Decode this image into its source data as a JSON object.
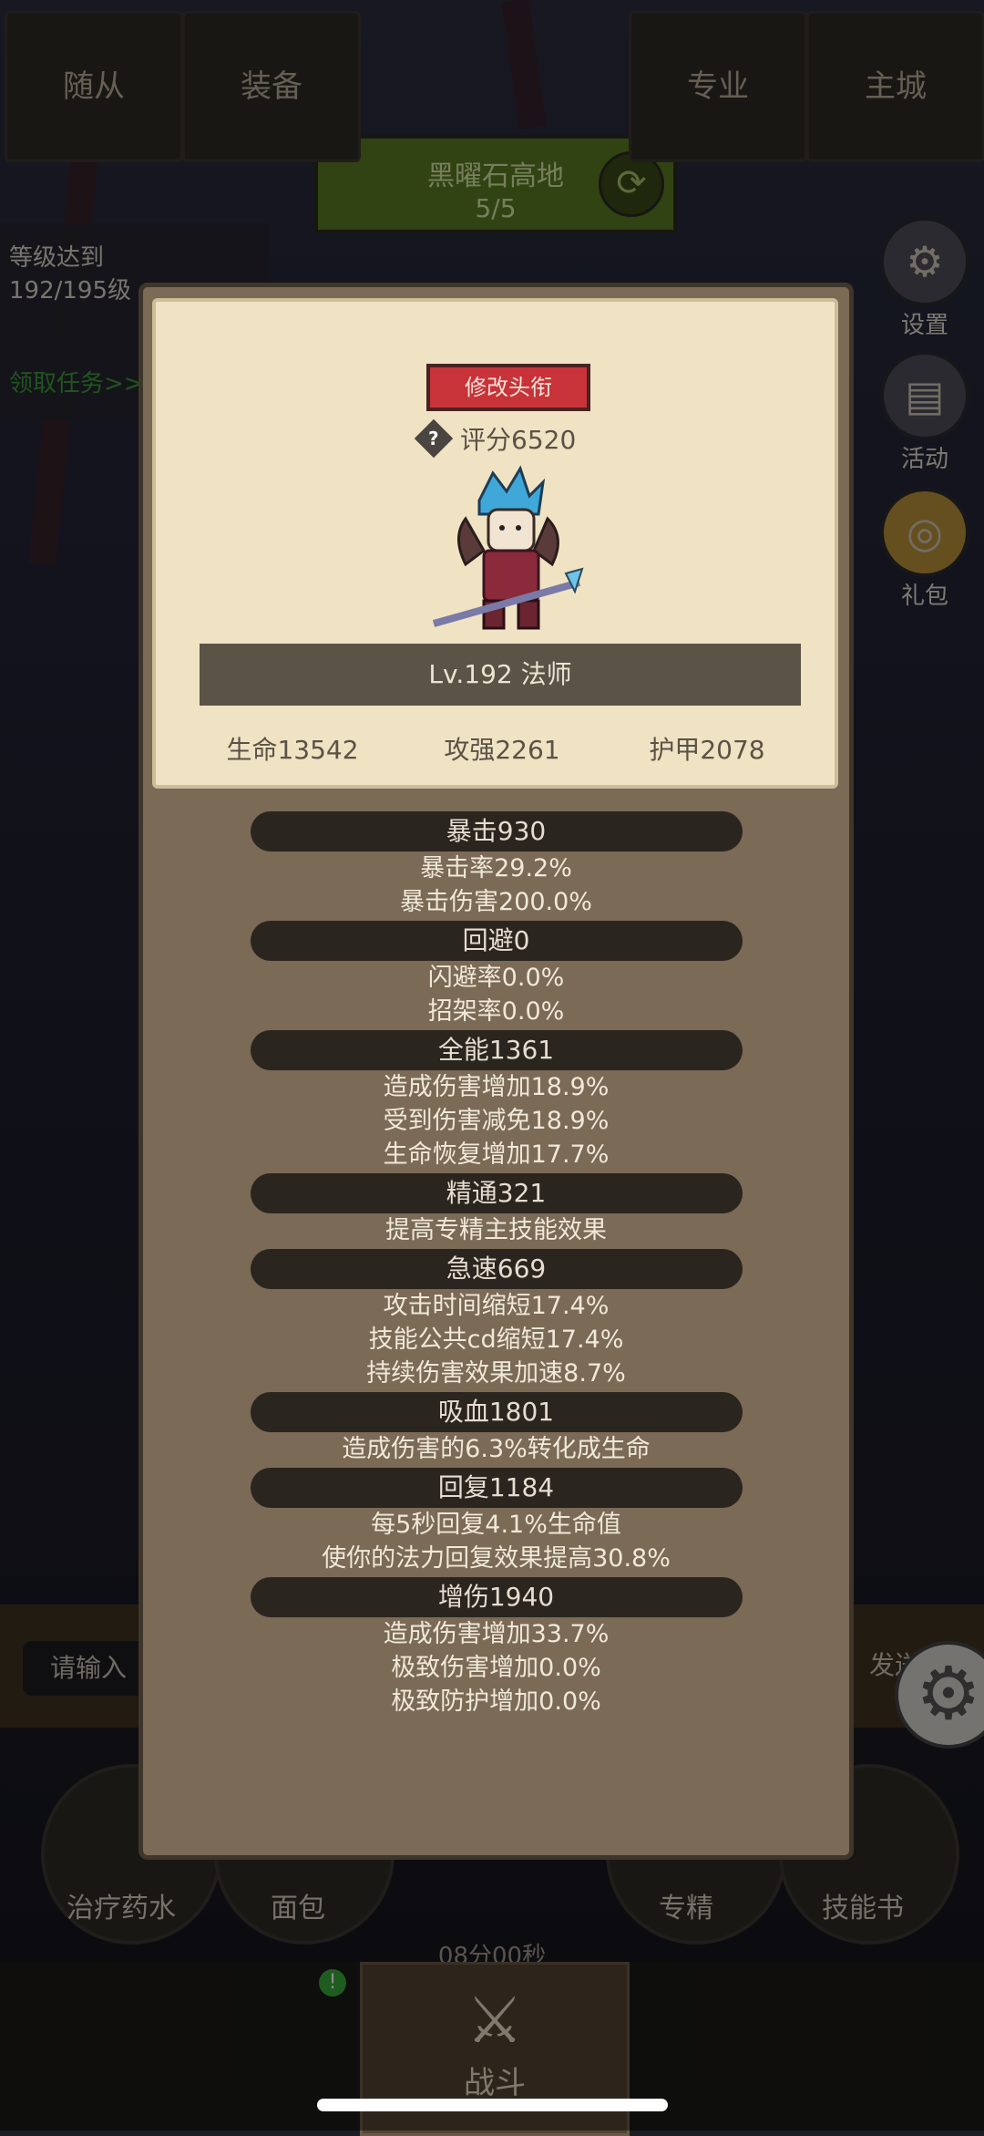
{
  "game": {
    "zone": {
      "name": "黑曜石高地",
      "progress": "5/5"
    },
    "task": {
      "text": "等级达到192/195级",
      "link": "领取任务>>"
    },
    "side_buttons": [
      {
        "label": "设置",
        "icon": "gear-icon"
      },
      {
        "label": "活动",
        "icon": "scroll-icon"
      },
      {
        "label": "礼包",
        "icon": "gift-icon"
      }
    ],
    "chat": {
      "placeholder": "请输入",
      "send_label": "发送"
    },
    "skills": [
      {
        "label": "治疗药水",
        "icon": "potion-icon"
      },
      {
        "label": "面包",
        "icon": "bread-icon"
      },
      {
        "label": "专精",
        "icon": "spec-icon"
      },
      {
        "label": "技能书",
        "icon": "book-icon"
      }
    ],
    "timer": "08分00秒",
    "nav": [
      {
        "label": "随从"
      },
      {
        "label": "装备",
        "badge": "!"
      },
      {
        "label": "战斗"
      },
      {
        "label": "专业"
      },
      {
        "label": "主城"
      }
    ]
  },
  "modal": {
    "title_button": "修改头衔",
    "score": "评分6520",
    "level_class": "Lv.192 法师",
    "core_stats": [
      {
        "label": "生命13542"
      },
      {
        "label": "攻强2261"
      },
      {
        "label": "护甲2078"
      }
    ],
    "groups": [
      {
        "header": "暴击930",
        "lines": [
          "暴击率29.2%",
          "暴击伤害200.0%"
        ]
      },
      {
        "header": "回避0",
        "lines": [
          "闪避率0.0%",
          "招架率0.0%"
        ]
      },
      {
        "header": "全能1361",
        "lines": [
          "造成伤害增加18.9%",
          "受到伤害减免18.9%",
          "生命恢复增加17.7%"
        ]
      },
      {
        "header": "精通321",
        "lines": [
          "提高专精主技能效果"
        ]
      },
      {
        "header": "急速669",
        "lines": [
          "攻击时间缩短17.4%",
          "技能公共cd缩短17.4%",
          "持续伤害效果加速8.7%"
        ]
      },
      {
        "header": "吸血1801",
        "lines": [
          "造成伤害的6.3%转化成生命"
        ]
      },
      {
        "header": "回复1184",
        "lines": [
          "每5秒回复4.1%生命值",
          "使你的法力回复效果提高30.8%"
        ]
      },
      {
        "header": "增伤1940",
        "lines": [
          "造成伤害增加33.7%",
          "极致伤害增加0.0%",
          "极致防护增加0.0%"
        ]
      }
    ]
  },
  "colors": {
    "title_button": "#c8333a",
    "panel": "#7a6a56",
    "parchment": "#efe3c4",
    "header_pill": "#2b2520"
  }
}
